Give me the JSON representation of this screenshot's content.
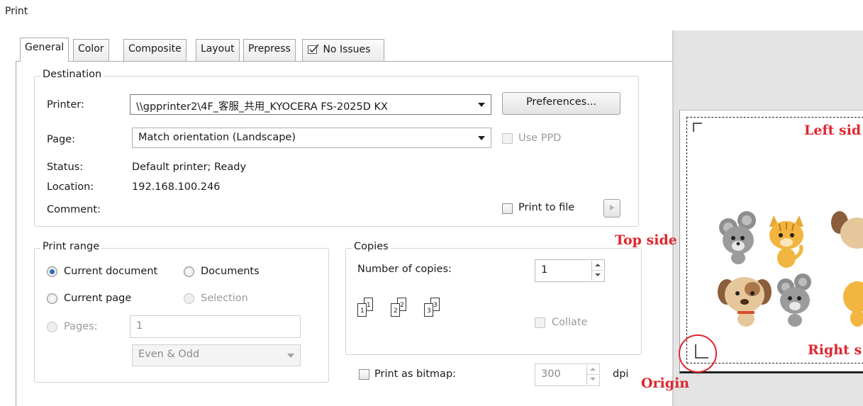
{
  "window": {
    "title": "Print"
  },
  "tabs": [
    {
      "label": "General",
      "active": true
    },
    {
      "label": "Color"
    },
    {
      "label": "Composite"
    },
    {
      "label": "Layout"
    },
    {
      "label": "Prepress"
    },
    {
      "label": "No Issues",
      "icon": "issues-check-icon"
    }
  ],
  "destination": {
    "legend": "Destination",
    "printer_label": "Printer:",
    "printer_value": "\\\\gpprinter2\\4F_客服_共用_KYOCERA FS-2025D KX",
    "preferences_button": "Preferences...",
    "page_label": "Page:",
    "page_value": "Match orientation (Landscape)",
    "use_ppd_label": "Use PPD",
    "status_label": "Status:",
    "status_value": "Default printer; Ready",
    "location_label": "Location:",
    "location_value": "192.168.100.246",
    "comment_label": "Comment:",
    "print_to_file_label": "Print to file"
  },
  "print_range": {
    "legend": "Print range",
    "current_document": "Current document",
    "documents": "Documents",
    "current_page": "Current page",
    "selection": "Selection",
    "pages_label": "Pages:",
    "pages_value": "1",
    "subset_value": "Even & Odd"
  },
  "copies": {
    "legend": "Copies",
    "number_label": "Number of copies:",
    "number_value": "1",
    "collate_label": "Collate",
    "collate_icon_pages": [
      "1",
      "1",
      "2",
      "2",
      "3",
      "3"
    ]
  },
  "bitmap": {
    "label": "Print as bitmap:",
    "dpi_value": "300",
    "dpi_unit": "dpi"
  },
  "annotations": {
    "left_side": "Left sid",
    "top_side": "Top side",
    "right_side": "Right s",
    "origin": "Origin"
  },
  "colors": {
    "annotation": "#e0262e",
    "radio_selected": "#2a6fbf"
  }
}
